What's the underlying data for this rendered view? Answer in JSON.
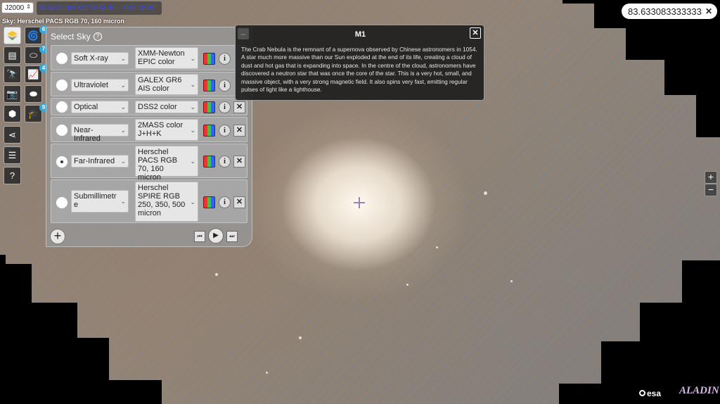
{
  "top_bar": {
    "frame": "J2000",
    "coords": "05 34 31.940 +22 00 52.20",
    "fov": "FoV: 32.55'",
    "sky_label": "Sky: Herschel PACS RGB 70, 160 micron"
  },
  "search": {
    "value": "83.6330833333333"
  },
  "toolbar": {
    "badges": [
      "6",
      "7",
      "4",
      "9"
    ]
  },
  "panel": {
    "title": "Select Sky",
    "rows": [
      {
        "band": "Soft X-ray",
        "survey": "XMM-Newton EPIC color",
        "selected": false,
        "deletable": false
      },
      {
        "band": "Ultraviolet",
        "survey": "GALEX GR6 AIS color",
        "selected": false,
        "deletable": false
      },
      {
        "band": "Optical",
        "survey": "DSS2 color",
        "selected": false,
        "deletable": true
      },
      {
        "band": "Near-Infrared",
        "survey": "2MASS color J+H+K",
        "selected": false,
        "deletable": true
      },
      {
        "band": "Far-Infrared",
        "survey": "Herschel PACS RGB 70, 160 micron",
        "selected": true,
        "deletable": true
      },
      {
        "band": "Submillimetre",
        "survey": "Herschel SPIRE RGB 250, 350, 500 micron",
        "selected": false,
        "deletable": true
      }
    ]
  },
  "popup": {
    "title": "M1",
    "text": "The Crab Nebula is the remnant of a supernova observed by Chinese astronomers in 1054. A star much more massive than our Sun exploded at the end of its life, creating a cloud of dust and hot gas that is expanding into space. In the centre of the cloud, astronomers have discovered a neutron star that was once the core of the star. This is a very hot, small, and massive object, with a very strong magnetic field. It also spins very fast, emitting regular pulses of light like a lighthouse."
  },
  "logos": {
    "esa": "esa",
    "aladin": "ALADIN"
  }
}
